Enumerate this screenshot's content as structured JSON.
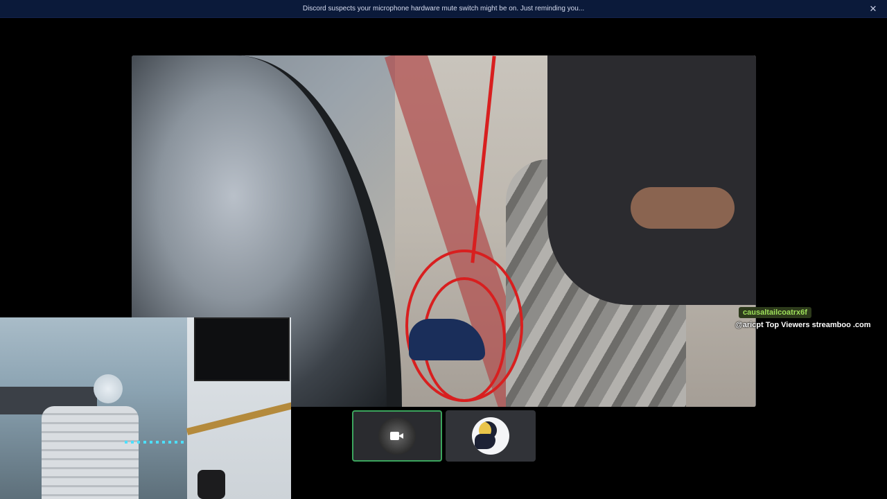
{
  "notice": {
    "message": "Discord suspects your microphone hardware mute switch might be on. Just reminding you...",
    "close_icon": "close-icon"
  },
  "stream": {
    "overlay_username": "causaltailcoatrx6f",
    "overlay_caption": "@aricpt Top Viewers streamboo .com"
  },
  "participants": [
    {
      "name": "",
      "icon": "video-camera-icon",
      "state": "camera-on",
      "active": true
    },
    {
      "name": "",
      "icon": "moon-avatar",
      "state": "avatar"
    }
  ],
  "colors": {
    "banner_bg": "#0b1a3a",
    "active_outline": "#3ba55d",
    "overlay_name": "#9ee05a"
  }
}
